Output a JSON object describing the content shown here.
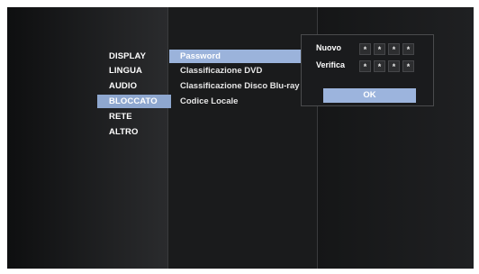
{
  "categories": [
    "DISPLAY",
    "LINGUA",
    "AUDIO",
    "BLOCCATO",
    "RETE",
    "ALTRO"
  ],
  "selected_category_index": 3,
  "options": [
    {
      "label": "Password",
      "selected": true
    },
    {
      "label": "Classificazione DVD",
      "selected": false
    },
    {
      "label": "Classificazione Disco Blu-ray",
      "selected": false
    },
    {
      "label": "Codice Locale",
      "selected": false
    }
  ],
  "colon": ":",
  "password_panel": {
    "new_label": "Nuovo",
    "verify_label": "Verifica",
    "new_digits": [
      "*",
      "*",
      "*",
      "*"
    ],
    "verify_digits": [
      "*",
      "*",
      "*",
      "*"
    ],
    "ok_label": "OK"
  },
  "colors": {
    "selected_highlight": "#9bb3db",
    "background": "#1d1e20"
  }
}
